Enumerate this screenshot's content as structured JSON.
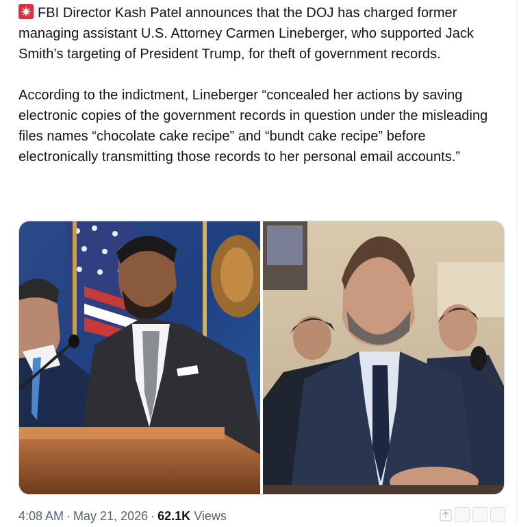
{
  "post": {
    "paragraph1": "FBI Director Kash Patel announces that the DOJ has charged former managing assistant U.S. Attorney Carmen Lineberger, who supported Jack Smith’s targeting of President Trump, for theft of government records.",
    "paragraph2": "According to the indictment, Lineberger “concealed her actions by saving electronic copies of the government records in question under the misleading files names “chocolate cake recipe” and “bundt cake recipe” before electronically transmitting those records to her personal email accounts.”",
    "emoji_icon": "rotating-light-icon"
  },
  "meta": {
    "time": "4:08 AM",
    "date": "May 21, 2026",
    "views_count": "62.1K",
    "views_label": "Views"
  },
  "colors": {
    "text": "#0f1419",
    "secondary": "#536471",
    "border": "#cfd9de"
  }
}
